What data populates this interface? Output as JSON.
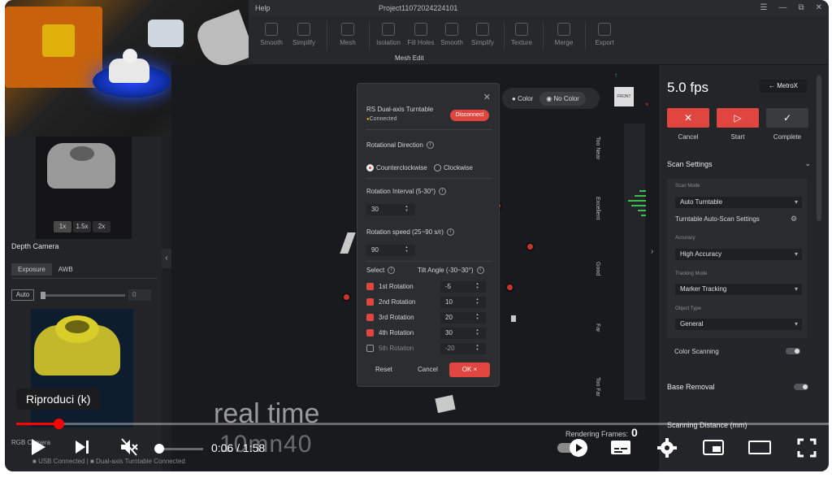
{
  "app": {
    "menu_help": "Help",
    "project_title": "Project11072024224101"
  },
  "toolbar": {
    "items": [
      "Smooth",
      "Simplify",
      "Mesh",
      "Isolation",
      "Fill Holes",
      "Smooth",
      "Simplify",
      "Texture",
      "Merge",
      "Export"
    ],
    "group_label": "Mesh Edit"
  },
  "left_panel": {
    "zoom_options": [
      "1x",
      "1.5x",
      "2x"
    ],
    "depth_camera_label": "Depth Camera",
    "tabs": [
      "Exposure",
      "AWB"
    ],
    "auto_label": "Auto",
    "exposure_value": "0",
    "rgb_camera_label": "RGB Camera"
  },
  "viewport": {
    "color_label": "Color",
    "no_color_label": "No Color",
    "quality_labels": [
      "Too Near",
      "Excellent",
      "Good",
      "Far",
      "Too Far"
    ],
    "rendering_label": "Rendering Frames:",
    "rendering_value": "0"
  },
  "dialog": {
    "title": "RS Dual-axis Turntable",
    "status": "Connected",
    "disconnect_label": "Disconnect",
    "rotational_direction_label": "Rotational Direction",
    "counterclockwise_label": "Counterclockwise",
    "clockwise_label": "Clockwise",
    "rotation_interval_label": "Rotation Interval (5-30°)",
    "rotation_interval_value": "30",
    "rotation_speed_label": "Rotation speed (25~90 s/r)",
    "rotation_speed_value": "90",
    "select_label": "Select",
    "tilt_label": "Tilt Angle (-30~30°)",
    "rotations": [
      {
        "label": "1st Rotation",
        "checked": true,
        "angle": "-5"
      },
      {
        "label": "2nd Rotation",
        "checked": true,
        "angle": "10"
      },
      {
        "label": "3rd Rotation",
        "checked": true,
        "angle": "20"
      },
      {
        "label": "4th Rotation",
        "checked": true,
        "angle": "30"
      },
      {
        "label": "5th Rotation",
        "checked": false,
        "angle": "-20"
      }
    ],
    "reset_label": "Reset",
    "cancel_label": "Cancel",
    "ok_label": "OK"
  },
  "right_panel": {
    "fps": "5.0 fps",
    "metrox_label": "MetroX",
    "cancel_label": "Cancel",
    "start_label": "Start",
    "complete_label": "Complete",
    "scan_settings_label": "Scan Settings",
    "scan_mode_label": "Scan Mode",
    "scan_mode_value": "Auto Turntable",
    "auto_scan_settings_label": "Turntable Auto-Scan Settings",
    "accuracy_label": "Accuracy",
    "accuracy_value": "High Accuracy",
    "tracking_mode_label": "Tracking Mode",
    "tracking_mode_value": "Marker Tracking",
    "object_type_label": "Object Type",
    "object_type_value": "General",
    "color_scanning_label": "Color Scanning",
    "base_removal_label": "Base Removal",
    "scanning_distance_label": "Scanning Distance (mm)"
  },
  "overlay": {
    "caption_line1": "real time",
    "caption_line2": "10mn40",
    "tooltip": "Riproduci (k)",
    "status_usb": "USB Connected",
    "status_turntable": "Dual-axis Turntable Connected"
  },
  "player": {
    "current_time": "0:06",
    "duration": "1:58",
    "progress_percent": 5.2,
    "accent_color": "#ff0000"
  }
}
